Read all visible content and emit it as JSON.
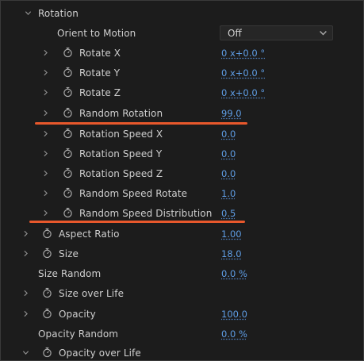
{
  "section": {
    "label": "Rotation"
  },
  "orient": {
    "label": "Orient to Motion",
    "value": "Off"
  },
  "rows": [
    {
      "label": "Rotate X",
      "value": "0 x+0.0 °"
    },
    {
      "label": "Rotate Y",
      "value": "0 x+0.0 °"
    },
    {
      "label": "Rotate Z",
      "value": "0 x+0.0 °"
    },
    {
      "label": "Random Rotation",
      "value": "99.0"
    },
    {
      "label": "Rotation Speed X",
      "value": "0.0"
    },
    {
      "label": "Rotation Speed Y",
      "value": "0.0"
    },
    {
      "label": "Rotation Speed Z",
      "value": "0.0"
    },
    {
      "label": "Random Speed Rotate",
      "value": "1.0"
    },
    {
      "label": "Random Speed Distribution",
      "value": "0.5"
    },
    {
      "label": "Aspect Ratio",
      "value": "1.00"
    },
    {
      "label": "Size",
      "value": "18.0"
    },
    {
      "label": "Size Random",
      "value": "0.0 %"
    },
    {
      "label": "Size over Life",
      "value": ""
    },
    {
      "label": "Opacity",
      "value": "100.0"
    },
    {
      "label": "Opacity Random",
      "value": "0.0 %"
    },
    {
      "label": "Opacity over Life",
      "value": ""
    }
  ],
  "colors": {
    "value": "#5f9ee6",
    "highlight": "#e8582c",
    "background": "#1c1c1c"
  },
  "icons": {
    "expand": "chevron-right-icon",
    "collapse": "chevron-down-icon",
    "keyframe": "stopwatch-icon"
  }
}
